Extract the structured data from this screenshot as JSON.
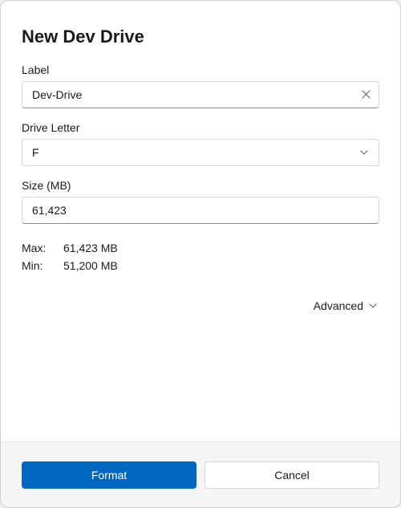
{
  "title": "New Dev Drive",
  "fields": {
    "label": {
      "caption": "Label",
      "value": "Dev-Drive"
    },
    "drive_letter": {
      "caption": "Drive Letter",
      "value": "F"
    },
    "size": {
      "caption": "Size (MB)",
      "value": "61,423"
    }
  },
  "limits": {
    "max_key": "Max:",
    "max_value": "61,423 MB",
    "min_key": "Min:",
    "min_value": "51,200 MB"
  },
  "advanced_label": "Advanced",
  "buttons": {
    "primary": "Format",
    "secondary": "Cancel"
  }
}
